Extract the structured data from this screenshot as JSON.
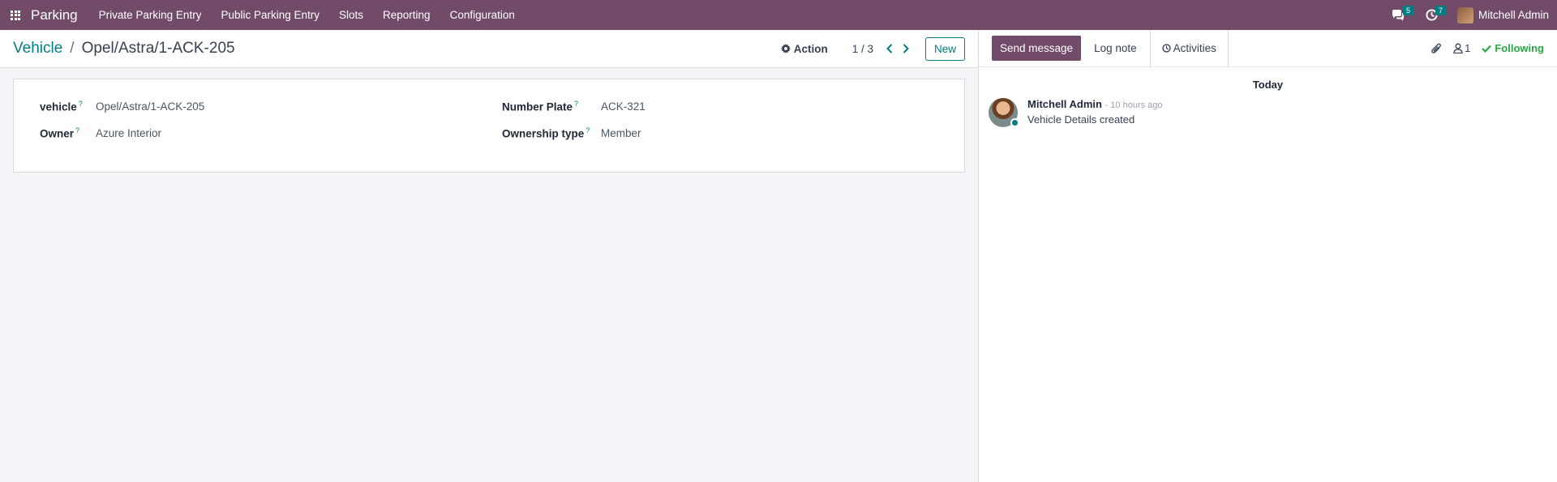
{
  "navbar": {
    "brand": "Parking",
    "items": [
      {
        "label": "Private Parking Entry"
      },
      {
        "label": "Public Parking Entry"
      },
      {
        "label": "Slots"
      },
      {
        "label": "Reporting"
      },
      {
        "label": "Configuration"
      }
    ],
    "messages_count": "5",
    "activities_count": "7",
    "user_name": "Mitchell Admin",
    "brand_color": "#714b67",
    "accent_color": "#017e84"
  },
  "control": {
    "breadcrumb_parent": "Vehicle",
    "breadcrumb_separator": "/",
    "breadcrumb_current": "Opel/Astra/1-ACK-205",
    "action_label": "Action",
    "pager": "1 / 3",
    "new_label": "New"
  },
  "form": {
    "vehicle_label": "vehicle",
    "vehicle_value": "Opel/Astra/1-ACK-205",
    "owner_label": "Owner",
    "owner_value": "Azure Interior",
    "plate_label": "Number Plate",
    "plate_value": "ACK-321",
    "ownership_label": "Ownership type",
    "ownership_value": "Member",
    "help_mark": "?"
  },
  "chatter": {
    "send_label": "Send message",
    "log_label": "Log note",
    "activities_label": "Activities",
    "followers_count": "1",
    "following_label": "Following",
    "day_label": "Today",
    "message": {
      "author": "Mitchell Admin",
      "time": "- 10 hours ago",
      "text": "Vehicle Details created"
    }
  }
}
